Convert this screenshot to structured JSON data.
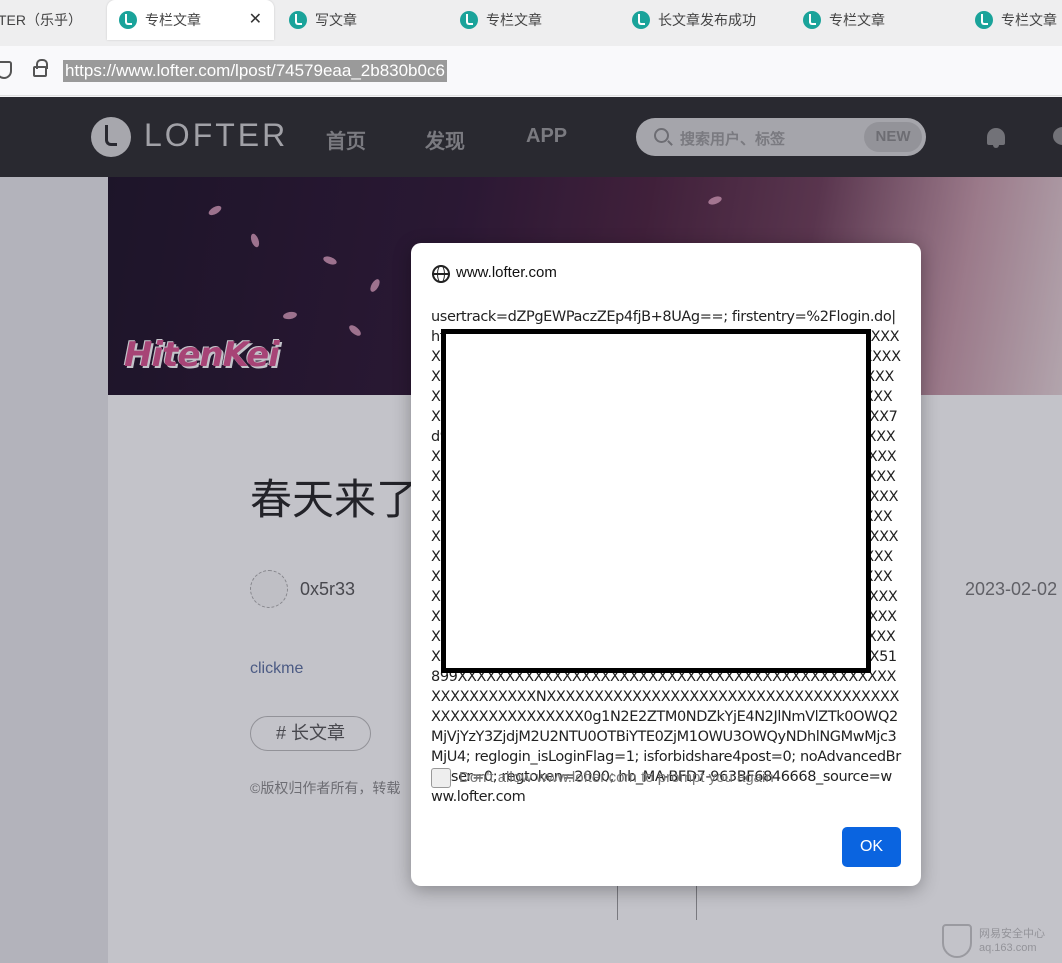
{
  "browser": {
    "tabs": [
      {
        "title": "TER（乐乎）",
        "active": false
      },
      {
        "title": "专栏文章",
        "active": true
      },
      {
        "title": "写文章",
        "active": false
      },
      {
        "title": "专栏文章",
        "active": false
      },
      {
        "title": "长文章发布成功",
        "active": false
      },
      {
        "title": "专栏文章",
        "active": false
      },
      {
        "title": "专栏文章",
        "active": false
      }
    ],
    "close_glyph": "✕",
    "url": "https://www.lofter.com/lpost/74579eaa_2b830b0c6"
  },
  "site_header": {
    "logo_text": "LOFTER",
    "nav": [
      "首页",
      "发现",
      "APP"
    ],
    "search_placeholder": "搜索用户、标签",
    "new_badge": "NEW"
  },
  "banner": {
    "logo_text": "HitenKei"
  },
  "post": {
    "title": "春天来了",
    "author": "0x5r33",
    "date": "2023-02-02",
    "link_text": "clickme",
    "tag": "# 长文章",
    "copyright": "©版权归作者所有，转载"
  },
  "watermark": {
    "line1": "网易安全中心",
    "line2": "aq.163.com"
  },
  "dialog": {
    "origin": "www.lofter.com",
    "message": "usertrack=dZPgEWPaczZEp4fjB+8UAg==; firstentry=%2Flogin.do|https%XXXXXXXXXXXXXXXXXXXXXXXXXXXXXXXXXXXXXXXXXXXXXXXXXXXXXXXXXXXXXcec727XXXXXXXXXXXXXXXXXXXXXXXXXXXXXXXXXXXXXXXXXXXXXXXXXXXXXX368257XXXXXXXXXXXXXXXXXXXXXXXXXXXXXXXXXXXXXXXXXXXXXXXXXXXXXX21a73cXXXXXXXXXXXXXXXXXXXXXXXXXXXXXXXXXXXXXXXXXXXXXXXXXXXXX7d999XXXXXXXXXXXXXXXXXXXXXXXXXXXXXXXXXXXXXXXXXXXXXXXXXXXXXXXXXLOXXXXXXXXXXXXXXXXXXXXXXXXXXXXXXXXXXXXXXXXXXXXXXXXXXXXXXR-PlXXXXXXXXXXXXXXXXXXXXXXXXXXXXXXXXXXXXXXXXXXXXXXXXXXXXXXXXXXAXXXXXXXXXXXXXXXXXXXXXXXXXXXXXXXXXXXXXXXXXXXXXXXXXXXXXXXQ2XniXXXXXXXXXXXXXXXXXXXXXXXXXXXXXXXXXXXXXXXXXXXXXXXXXXXXXXXXXtoXXXXXXXXXXXXXXXXXXXXXXXXXXXXXXXXXXXXXXXXXXXXXXXXXXXXXQ2XniXXXXXXXXXXXXXXXXXXXXXXXXXXXXXXXXXXXXXXXXXXXXXXXXXXXXXXXXXpXXXXXXXXXXXXXXXXXXXXXXXXXXXXXXXXXXXXXXXXXXXXXXXXXXXXXXXXXXX45XXXXXXXXXXXXXXXXXXXXXXXXXXXXXXXXXXXXXXXXXXXXXXXXXXXXXXXXXX_XXXXXXXXXXXXXXXXXXXXXXXXXXXXXXXXXXXXXXXXXXXXXXXXXXXX51899XXXXXXXXXXXXXXXXXXXXXXXXXXXXXXXXXXXXXXXXXXXXXXXXXXXXXXXXXNXXXXXXXXXXXXXXXXXXXXXXXXXXXXXXXXXXXXXXXXXXXXXXXXXXXXX0g1N2E2ZTM0NDZkYjE4N2JlNmVlZTk0OWQ2MjVjYzY3ZjdjM2U2NTU0OTBiYTE0ZjM1OWU3OWQyNDhlNGMwMjc3MjU4; reglogin_isLoginFlag=1; isforbidshare4post=0; noAdvancedBrowser=0; regtoken=2000; hb_MA-BFD7-963BF6846668_source=www.lofter.com",
    "checkbox_label": "Don't allow www.lofter.com to prompt you again",
    "ok_label": "OK"
  }
}
